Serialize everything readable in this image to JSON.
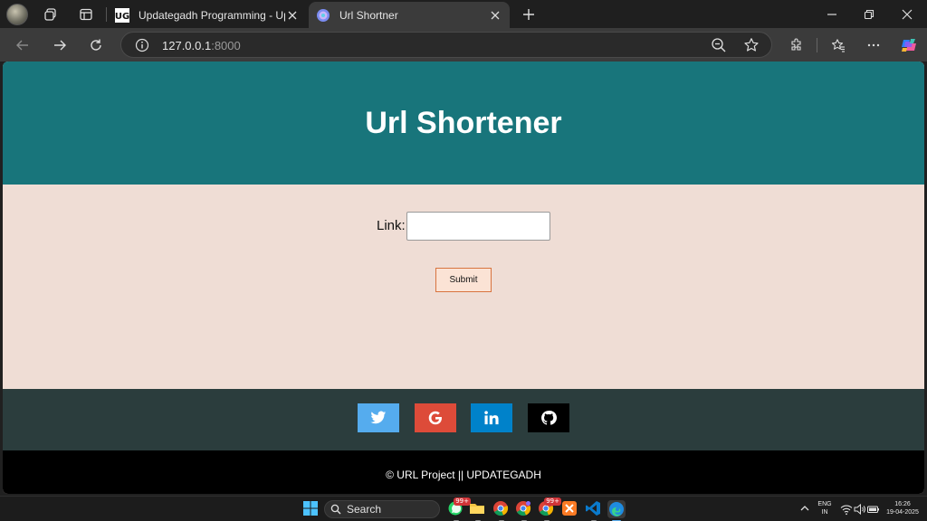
{
  "browser": {
    "tabs": [
      {
        "title": "Updategadh Programming - Upd",
        "active": false,
        "favicon": "updategadh-favicon"
      },
      {
        "title": "Url Shortner",
        "active": true,
        "favicon": "edge-copilot-favicon"
      }
    ],
    "address": {
      "host": "127.0.0.1",
      "port": ":8000"
    }
  },
  "page": {
    "heading": "Url Shortener",
    "form": {
      "label": "Link:",
      "input_value": "",
      "submit_label": "Submit"
    },
    "social": [
      {
        "name": "twitter",
        "color": "#55acee"
      },
      {
        "name": "google",
        "color": "#dd4b39"
      },
      {
        "name": "linkedin",
        "color": "#0082ca"
      },
      {
        "name": "github",
        "color": "#000000"
      }
    ],
    "footer": "© URL Project || UPDATEGADH",
    "colors": {
      "header": "#18757b",
      "body": "#efddd5",
      "social_bar": "#2b3d3d",
      "footer": "#000000"
    }
  },
  "taskbar": {
    "search_label": "Search",
    "badges": [
      "99+",
      "99+"
    ],
    "tray": {
      "lang_top": "ENG",
      "lang_bottom": "IN",
      "time": "16:26",
      "date": "19-04-2025"
    }
  }
}
